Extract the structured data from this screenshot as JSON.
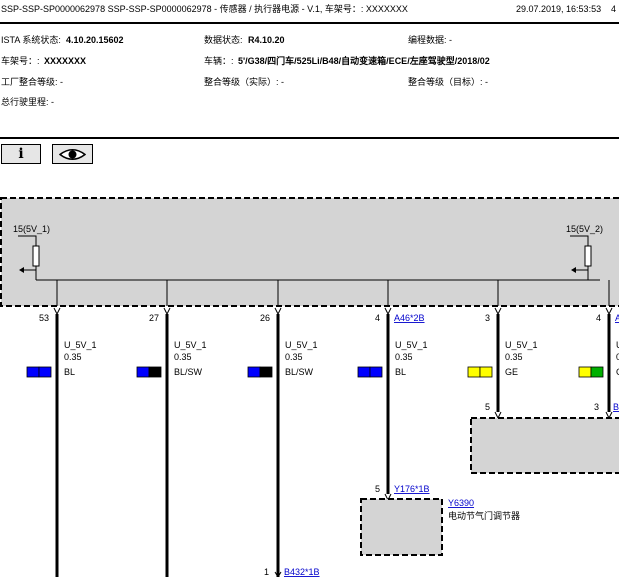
{
  "header": {
    "doc_id": "SSP-SSP-SP0000062978 SSP-SSP-SP0000062978 - 传感器 / 执行器电源 - V.1, 车架号：: XXXXXXX",
    "datetime": "29.07.2019, 16:53:53",
    "page": "4"
  },
  "info": {
    "ista_label": "ISTA 系统状态:",
    "ista_value": "4.10.20.15602",
    "datastate_label": "数据状态:",
    "datastate_value": "R4.10.20",
    "programming_label": "编程数据: -",
    "vin_label": "车架号：:",
    "vin_value": "XXXXXXX",
    "vehicle_label": "车辆：:",
    "vehicle_value": "5'/G38/四门车/525Li/B48/自动变速箱/ECE/左座驾驶型/2018/02",
    "factory_label": "工厂整合等级: -",
    "integration_actual_label": "整合等级（实际）: -",
    "integration_target_label": "整合等级（目标）: -",
    "mileage_label": "总行驶里程: -"
  },
  "toolbar": {
    "info_button": "i",
    "view_button": "eye"
  },
  "diagram": {
    "supplies": [
      {
        "label": "15(5V_1)"
      },
      {
        "label": "15(5V_2)"
      }
    ],
    "pins": [
      {
        "pin": "53",
        "signal": "U_5V_1",
        "gauge": "0.35",
        "color_name": "BL",
        "swatch": [
          "#0000ff",
          "#0000ff"
        ]
      },
      {
        "pin": "27",
        "signal": "U_5V_1",
        "gauge": "0.35",
        "color_name": "BL/SW",
        "swatch": [
          "#0000ff",
          "#000000"
        ]
      },
      {
        "pin": "26",
        "signal": "U_5V_1",
        "gauge": "0.35",
        "color_name": "BL/SW",
        "swatch": [
          "#0000ff",
          "#000000"
        ]
      },
      {
        "pin": "4",
        "signal": "U_5V_1",
        "gauge": "0.35",
        "color_name": "BL",
        "swatch": [
          "#0000ff",
          "#0000ff"
        ],
        "connector": "A46*2B"
      },
      {
        "pin": "3",
        "signal": "U_5V_1",
        "gauge": "0.35",
        "color_name": "GE",
        "swatch": [
          "#ffff00",
          "#ffff00"
        ]
      },
      {
        "pin": "4",
        "signal": "U",
        "gauge": "0",
        "color_name": "G",
        "swatch": [
          "#ffff00",
          "#00b000"
        ],
        "connector": "A"
      }
    ],
    "lower": {
      "pin5_a": "5",
      "pin3_b": "3",
      "pin_b_label": "B",
      "actuator_pin": "5",
      "actuator_connector": "Y176*1B",
      "actuator_id": "Y6390",
      "actuator_name": "电动节气门调节器",
      "bottom_pin": "1",
      "bottom_connector": "B432*1B"
    }
  },
  "colors": {
    "module_fill": "#d4d4d4",
    "link": "#0000cc",
    "wire": "#000000"
  }
}
